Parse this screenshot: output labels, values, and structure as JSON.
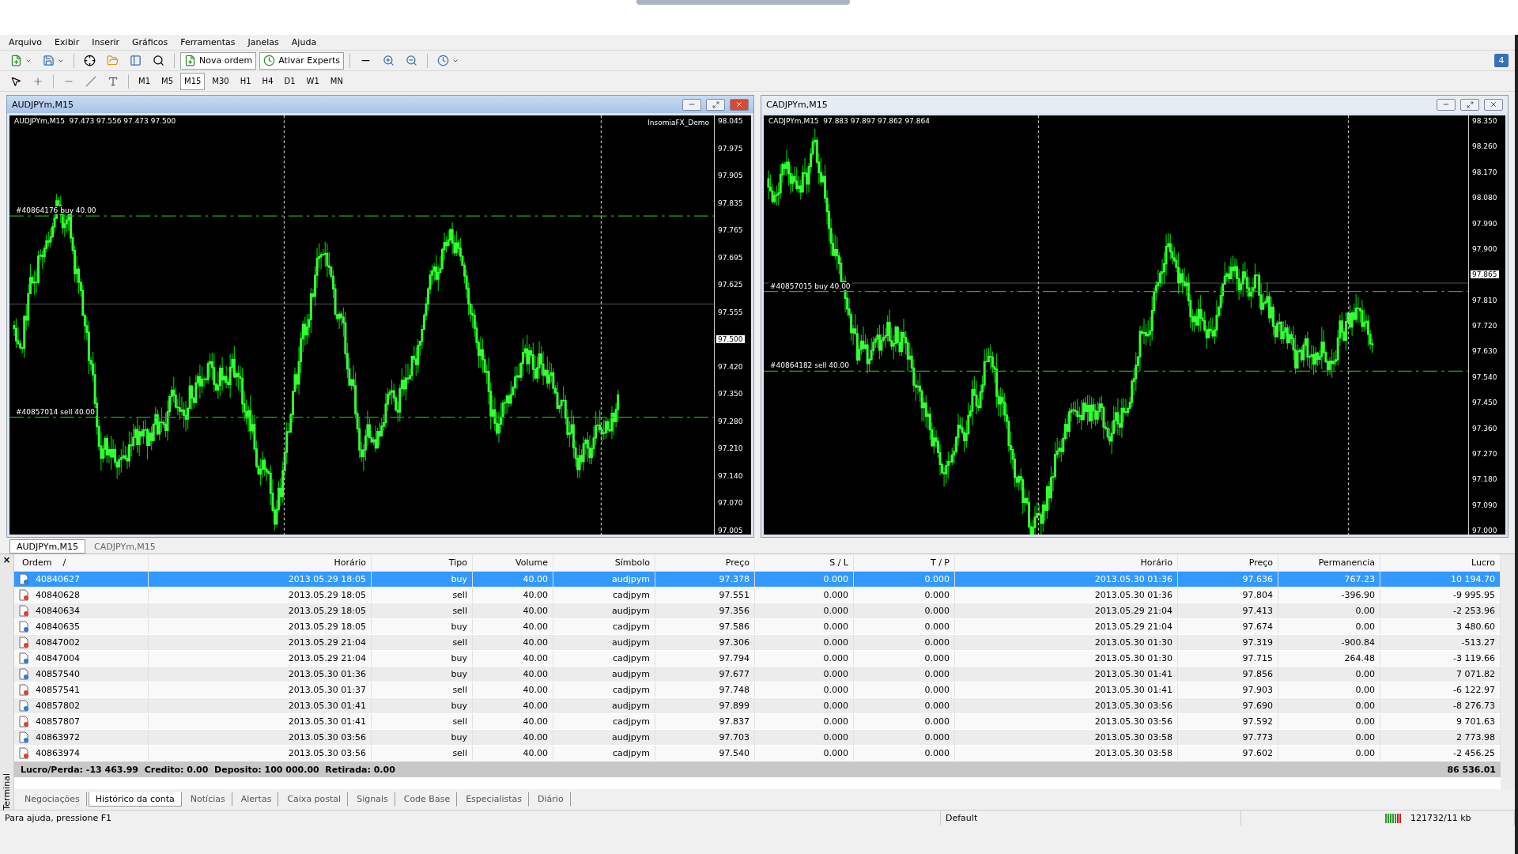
{
  "menu": [
    "Arquivo",
    "Exibir",
    "Inserir",
    "Gráficos",
    "Ferramentas",
    "Janelas",
    "Ajuda"
  ],
  "toolbar": {
    "new_order": "Nova ordem",
    "experts": "Ativar Experts",
    "notifications": "4"
  },
  "timeframes": [
    {
      "label": "M1",
      "selected": false
    },
    {
      "label": "M5",
      "selected": false
    },
    {
      "label": "M15",
      "selected": true
    },
    {
      "label": "M30",
      "selected": false
    },
    {
      "label": "H1",
      "selected": false
    },
    {
      "label": "H4",
      "selected": false
    },
    {
      "label": "D1",
      "selected": false
    },
    {
      "label": "W1",
      "selected": false
    },
    {
      "label": "MN",
      "selected": false
    }
  ],
  "charts": [
    {
      "title": "AUDJPYm,M15",
      "active": true,
      "info": "AUDJPYm,M15  97.473 97.556 97.473 97.500",
      "account": "InsomiaFX_Demo",
      "orders": [
        {
          "label": "#40864176 buy 40.00"
        },
        {
          "label": "#40857014 sell 40.00"
        }
      ],
      "price_axis": [
        {
          "text": "98.045",
          "current": false
        },
        {
          "text": "97.975",
          "current": false
        },
        {
          "text": "97.905",
          "current": false
        },
        {
          "text": "97.835",
          "current": false
        },
        {
          "text": "97.765",
          "current": false
        },
        {
          "text": "97.695",
          "current": false
        },
        {
          "text": "97.625",
          "current": false
        },
        {
          "text": "97.555",
          "current": false
        },
        {
          "text": "97.500",
          "current": true
        },
        {
          "text": "97.420",
          "current": false
        },
        {
          "text": "97.350",
          "current": false
        },
        {
          "text": "97.280",
          "current": false
        },
        {
          "text": "97.210",
          "current": false
        },
        {
          "text": "97.140",
          "current": false
        },
        {
          "text": "97.070",
          "current": false
        },
        {
          "text": "97.005",
          "current": false
        }
      ]
    },
    {
      "title": "CADJPYm,M15",
      "active": false,
      "info": "CADJPYm,M15  97.883 97.897 97.862 97.864",
      "orders": [
        {
          "label": "#40857015 buy 40.00"
        },
        {
          "label": "#40864182 sell 40.00"
        }
      ],
      "price_axis": [
        {
          "text": "98.350",
          "current": false
        },
        {
          "text": "98.260",
          "current": false
        },
        {
          "text": "98.170",
          "current": false
        },
        {
          "text": "98.080",
          "current": false
        },
        {
          "text": "97.990",
          "current": false
        },
        {
          "text": "97.900",
          "current": false
        },
        {
          "text": "97.865",
          "current": true
        },
        {
          "text": "97.810",
          "current": false
        },
        {
          "text": "97.720",
          "current": false
        },
        {
          "text": "97.630",
          "current": false
        },
        {
          "text": "97.540",
          "current": false
        },
        {
          "text": "97.450",
          "current": false
        },
        {
          "text": "97.360",
          "current": false
        },
        {
          "text": "97.270",
          "current": false
        },
        {
          "text": "97.180",
          "current": false
        },
        {
          "text": "97.090",
          "current": false
        },
        {
          "text": "97.000",
          "current": false
        }
      ]
    }
  ],
  "chart_tabs": [
    {
      "label": "AUDJPYm,M15",
      "selected": true
    },
    {
      "label": "CADJPYm,M15",
      "selected": false
    }
  ],
  "terminal": {
    "title": "Terminal",
    "close": "×",
    "columns": [
      "Ordem",
      "Horário",
      "Tipo",
      "Volume",
      "Símbolo",
      "Preço",
      "S / L",
      "T / P",
      "Horário",
      "Preço",
      "Permanencia",
      "Lucro"
    ],
    "sort_mark": "/",
    "rows": [
      {
        "kind": "buy",
        "selected": true,
        "cells": [
          "40840627",
          "2013.05.29 18:05",
          "buy",
          "40.00",
          "audjpym",
          "97.378",
          "0.000",
          "0.000",
          "2013.05.30 01:36",
          "97.636",
          "767.23",
          "10 194.70"
        ]
      },
      {
        "kind": "sell",
        "selected": false,
        "cells": [
          "40840628",
          "2013.05.29 18:05",
          "sell",
          "40.00",
          "cadjpym",
          "97.551",
          "0.000",
          "0.000",
          "2013.05.30 01:36",
          "97.804",
          "-396.90",
          "-9 995.95"
        ]
      },
      {
        "kind": "sell",
        "selected": false,
        "cells": [
          "40840634",
          "2013.05.29 18:05",
          "sell",
          "40.00",
          "audjpym",
          "97.356",
          "0.000",
          "0.000",
          "2013.05.29 21:04",
          "97.413",
          "0.00",
          "-2 253.96"
        ]
      },
      {
        "kind": "buy",
        "selected": false,
        "cells": [
          "40840635",
          "2013.05.29 18:05",
          "buy",
          "40.00",
          "cadjpym",
          "97.586",
          "0.000",
          "0.000",
          "2013.05.29 21:04",
          "97.674",
          "0.00",
          "3 480.60"
        ]
      },
      {
        "kind": "sell",
        "selected": false,
        "cells": [
          "40847002",
          "2013.05.29 21:04",
          "sell",
          "40.00",
          "audjpym",
          "97.306",
          "0.000",
          "0.000",
          "2013.05.30 01:30",
          "97.319",
          "-900.84",
          "-513.27"
        ]
      },
      {
        "kind": "buy",
        "selected": false,
        "cells": [
          "40847004",
          "2013.05.29 21:04",
          "buy",
          "40.00",
          "cadjpym",
          "97.794",
          "0.000",
          "0.000",
          "2013.05.30 01:30",
          "97.715",
          "264.48",
          "-3 119.66"
        ]
      },
      {
        "kind": "buy",
        "selected": false,
        "cells": [
          "40857540",
          "2013.05.30 01:36",
          "buy",
          "40.00",
          "audjpym",
          "97.677",
          "0.000",
          "0.000",
          "2013.05.30 01:41",
          "97.856",
          "0.00",
          "7 071.82"
        ]
      },
      {
        "kind": "sell",
        "selected": false,
        "cells": [
          "40857541",
          "2013.05.30 01:37",
          "sell",
          "40.00",
          "cadjpym",
          "97.748",
          "0.000",
          "0.000",
          "2013.05.30 01:41",
          "97.903",
          "0.00",
          "-6 122.97"
        ]
      },
      {
        "kind": "buy",
        "selected": false,
        "cells": [
          "40857802",
          "2013.05.30 01:41",
          "buy",
          "40.00",
          "audjpym",
          "97.899",
          "0.000",
          "0.000",
          "2013.05.30 03:56",
          "97.690",
          "0.00",
          "-8 276.73"
        ]
      },
      {
        "kind": "sell",
        "selected": false,
        "cells": [
          "40857807",
          "2013.05.30 01:41",
          "sell",
          "40.00",
          "cadjpym",
          "97.837",
          "0.000",
          "0.000",
          "2013.05.30 03:56",
          "97.592",
          "0.00",
          "9 701.63"
        ]
      },
      {
        "kind": "buy",
        "selected": false,
        "cells": [
          "40863972",
          "2013.05.30 03:56",
          "buy",
          "40.00",
          "audjpym",
          "97.703",
          "0.000",
          "0.000",
          "2013.05.30 03:58",
          "97.773",
          "0.00",
          "2 773.98"
        ]
      },
      {
        "kind": "sell",
        "selected": false,
        "cells": [
          "40863974",
          "2013.05.30 03:56",
          "sell",
          "40.00",
          "cadjpym",
          "97.540",
          "0.000",
          "0.000",
          "2013.05.30 03:58",
          "97.602",
          "0.00",
          "-2 456.25"
        ]
      }
    ],
    "summary": {
      "text": "Lucro/Perda: -13 463.99  Credito: 0.00  Deposito: 100 000.00  Retirada: 0.00",
      "total": "86 536.01"
    },
    "tabs": [
      {
        "label": "Negociações",
        "selected": false
      },
      {
        "label": "Histórico da conta",
        "selected": true
      },
      {
        "label": "Notícias",
        "selected": false
      },
      {
        "label": "Alertas",
        "selected": false
      },
      {
        "label": "Caixa postal",
        "selected": false
      },
      {
        "label": "Signals",
        "selected": false
      },
      {
        "label": "Code Base",
        "selected": false
      },
      {
        "label": "Especialistas",
        "selected": false
      },
      {
        "label": "Diário",
        "selected": false
      }
    ]
  },
  "status_bar": {
    "help": "Para ajuda, pressione F1",
    "profile": "Default",
    "traffic": "121732/11 kb"
  }
}
